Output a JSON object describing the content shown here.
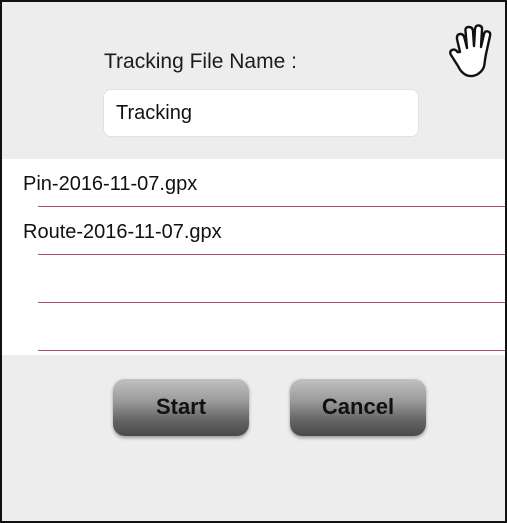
{
  "dialog": {
    "field_label": "Tracking File Name :",
    "file_name_value": "Tracking",
    "icon": "hand-icon"
  },
  "files": [
    {
      "name": "Pin-2016-11-07.gpx"
    },
    {
      "name": "Route-2016-11-07.gpx"
    },
    {
      "name": ""
    },
    {
      "name": ""
    }
  ],
  "buttons": {
    "start_label": "Start",
    "cancel_label": "Cancel"
  },
  "colors": {
    "separator": "#b04a7c",
    "background": "#ededed"
  }
}
